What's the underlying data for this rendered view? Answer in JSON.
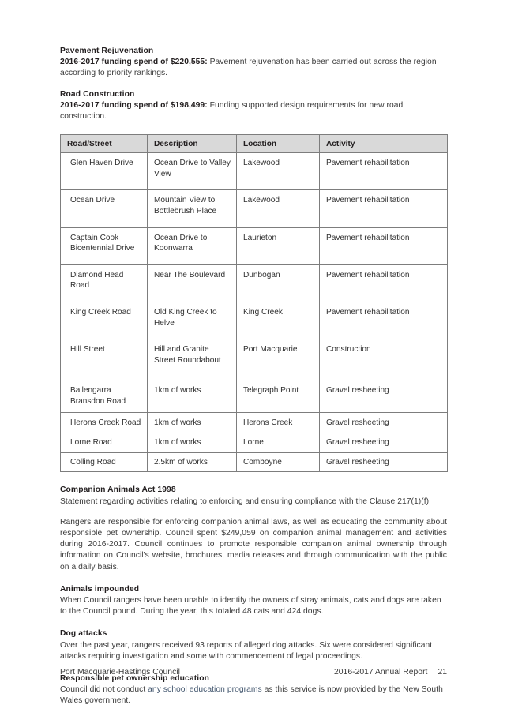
{
  "document": {
    "page_number": "21",
    "footer_left": "Port Macquarie-Hastings Council",
    "footer_right": "2016-2017 Annual Report"
  },
  "intro": {
    "pavement": {
      "heading": "Pavement Rejuvenation",
      "lead": "2016-2017 funding spend of $220,555:",
      "body": " Pavement rejuvenation has been carried out across the region according to priority rankings."
    },
    "road_construction": {
      "heading": "Road Construction",
      "lead": "2016-2017 funding spend of $198,499:",
      "body": " Funding supported design requirements for new road construction."
    }
  },
  "road_table": {
    "columns": [
      "Road/Street",
      "Description",
      "Location",
      "Activity"
    ],
    "rows": [
      {
        "road": "Glen Haven Drive",
        "description": "Ocean Drive to Valley View",
        "location": "Lakewood",
        "activity": "Pavement rehabilitation"
      },
      {
        "road": "Ocean Drive",
        "description": "Mountain View to Bottlebrush Place",
        "location": "Lakewood",
        "activity": "Pavement rehabilitation"
      },
      {
        "road": "Captain Cook Bicentennial Drive",
        "description": "Ocean Drive to Koonwarra",
        "location": "Laurieton",
        "activity": "Pavement rehabilitation"
      },
      {
        "road": "Diamond Head Road",
        "description": "Near The Boulevard",
        "location": "Dunbogan",
        "activity": "Pavement rehabilitation"
      },
      {
        "road": "King Creek Road",
        "description": "Old King Creek to Helve",
        "location": "King Creek",
        "activity": "Pavement rehabilitation"
      },
      {
        "road": "Hill Street",
        "description": "Hill and Granite Street Roundabout",
        "location": "Port Macquarie",
        "activity": "Construction"
      },
      {
        "road": "Ballengarra Bransdon Road",
        "description": "1km of works",
        "location": "Telegraph Point",
        "activity": "Gravel resheeting"
      },
      {
        "road": "Herons Creek Road",
        "description": "1km of works",
        "location": "Herons Creek",
        "activity": "Gravel resheeting"
      },
      {
        "road": "Lorne Road",
        "description": "1km of works",
        "location": "Lorne",
        "activity": "Gravel resheeting"
      },
      {
        "road": "Colling Road",
        "description": "2.5km of works",
        "location": "Comboyne",
        "activity": "Gravel resheeting"
      }
    ]
  },
  "companion_animals": {
    "heading": "Companion Animals Act 1998",
    "statement": "Statement regarding activities relating to enforcing and ensuring compliance with the Clause 217(1)(f)",
    "paragraph": "Rangers are responsible for enforcing companion animal laws, as well as educating the community about responsible pet ownership. Council spent $249,059 on companion animal management and activities during 2016-2017. Council continues to promote responsible companion animal ownership through information on Council's website, brochures, media releases and through communication with the public on a daily basis.",
    "impounded": {
      "heading": "Animals impounded",
      "body": "When Council rangers have been unable to identify the owners of stray animals, cats and dogs are taken to the Council pound. During the year, this totaled 48 cats and 424 dogs."
    },
    "dog_attacks": {
      "heading": "Dog attacks",
      "body": "Over the past year, rangers received 93 reports of alleged dog attacks. Six were considered significant attacks requiring investigation and some with commencement of legal proceedings."
    },
    "pet_education": {
      "heading": "Responsible pet ownership education",
      "body_part1": "Council did not conduct ",
      "body_tinted": "any school education programs",
      "body_part2": " as this service is now provided by the New South Wales government."
    }
  },
  "colors": {
    "table_header_bg": "#d9d9d9",
    "table_border": "#7d7d7d",
    "body_text": "#3b3b3b",
    "heading_text": "#231f20",
    "tint_text": "#42566e"
  }
}
